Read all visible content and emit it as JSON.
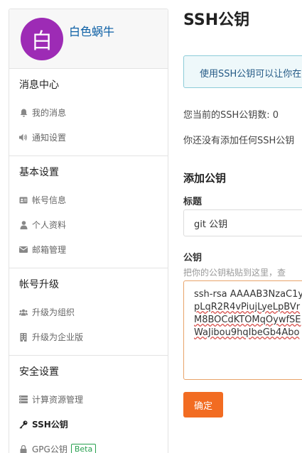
{
  "user": {
    "avatar_char": "白",
    "name": "白色蜗牛"
  },
  "sidebar": {
    "groups": [
      {
        "title": "消息中心",
        "items": [
          {
            "label": "我的消息",
            "icon": "bell-icon"
          },
          {
            "label": "通知设置",
            "icon": "volume-icon"
          }
        ]
      },
      {
        "title": "基本设置",
        "items": [
          {
            "label": "帐号信息",
            "icon": "id-card-icon"
          },
          {
            "label": "个人资料",
            "icon": "user-icon"
          },
          {
            "label": "邮箱管理",
            "icon": "envelope-icon"
          }
        ]
      },
      {
        "title": "帐号升级",
        "items": [
          {
            "label": "升级为组织",
            "icon": "users-icon"
          },
          {
            "label": "升级为企业版",
            "icon": "building-icon"
          }
        ]
      },
      {
        "title": "安全设置",
        "items": [
          {
            "label": "计算资源管理",
            "icon": "server-icon"
          },
          {
            "label": "SSH公钥",
            "icon": "key-icon",
            "active": true
          },
          {
            "label": "GPG公钥",
            "icon": "lock-icon",
            "badge": "Beta"
          }
        ]
      }
    ]
  },
  "main": {
    "title": "SSH公钥",
    "info": "使用SSH公钥可以让你在",
    "count_text": "您当前的SSH公钥数: 0",
    "none_text": "你还没有添加任何SSH公钥",
    "add_title": "添加公钥",
    "title_label": "标题",
    "title_value": "git 公钥",
    "key_label": "公钥",
    "key_help": "把你的公钥粘贴到这里，查",
    "key_value": [
      "ssh-rsa AAAAB3NzaC1y",
      "pLqR2R4vPiujLyeLpBVr",
      "M8BOCdKTOMqOywfSE",
      "WaJibou9hqIbeGb4Abo"
    ],
    "submit_label": "确定"
  },
  "colors": {
    "accent": "#f26c22",
    "avatar": "#9d2bb5",
    "link": "#0b5fa5",
    "beta": "#27a04e"
  }
}
